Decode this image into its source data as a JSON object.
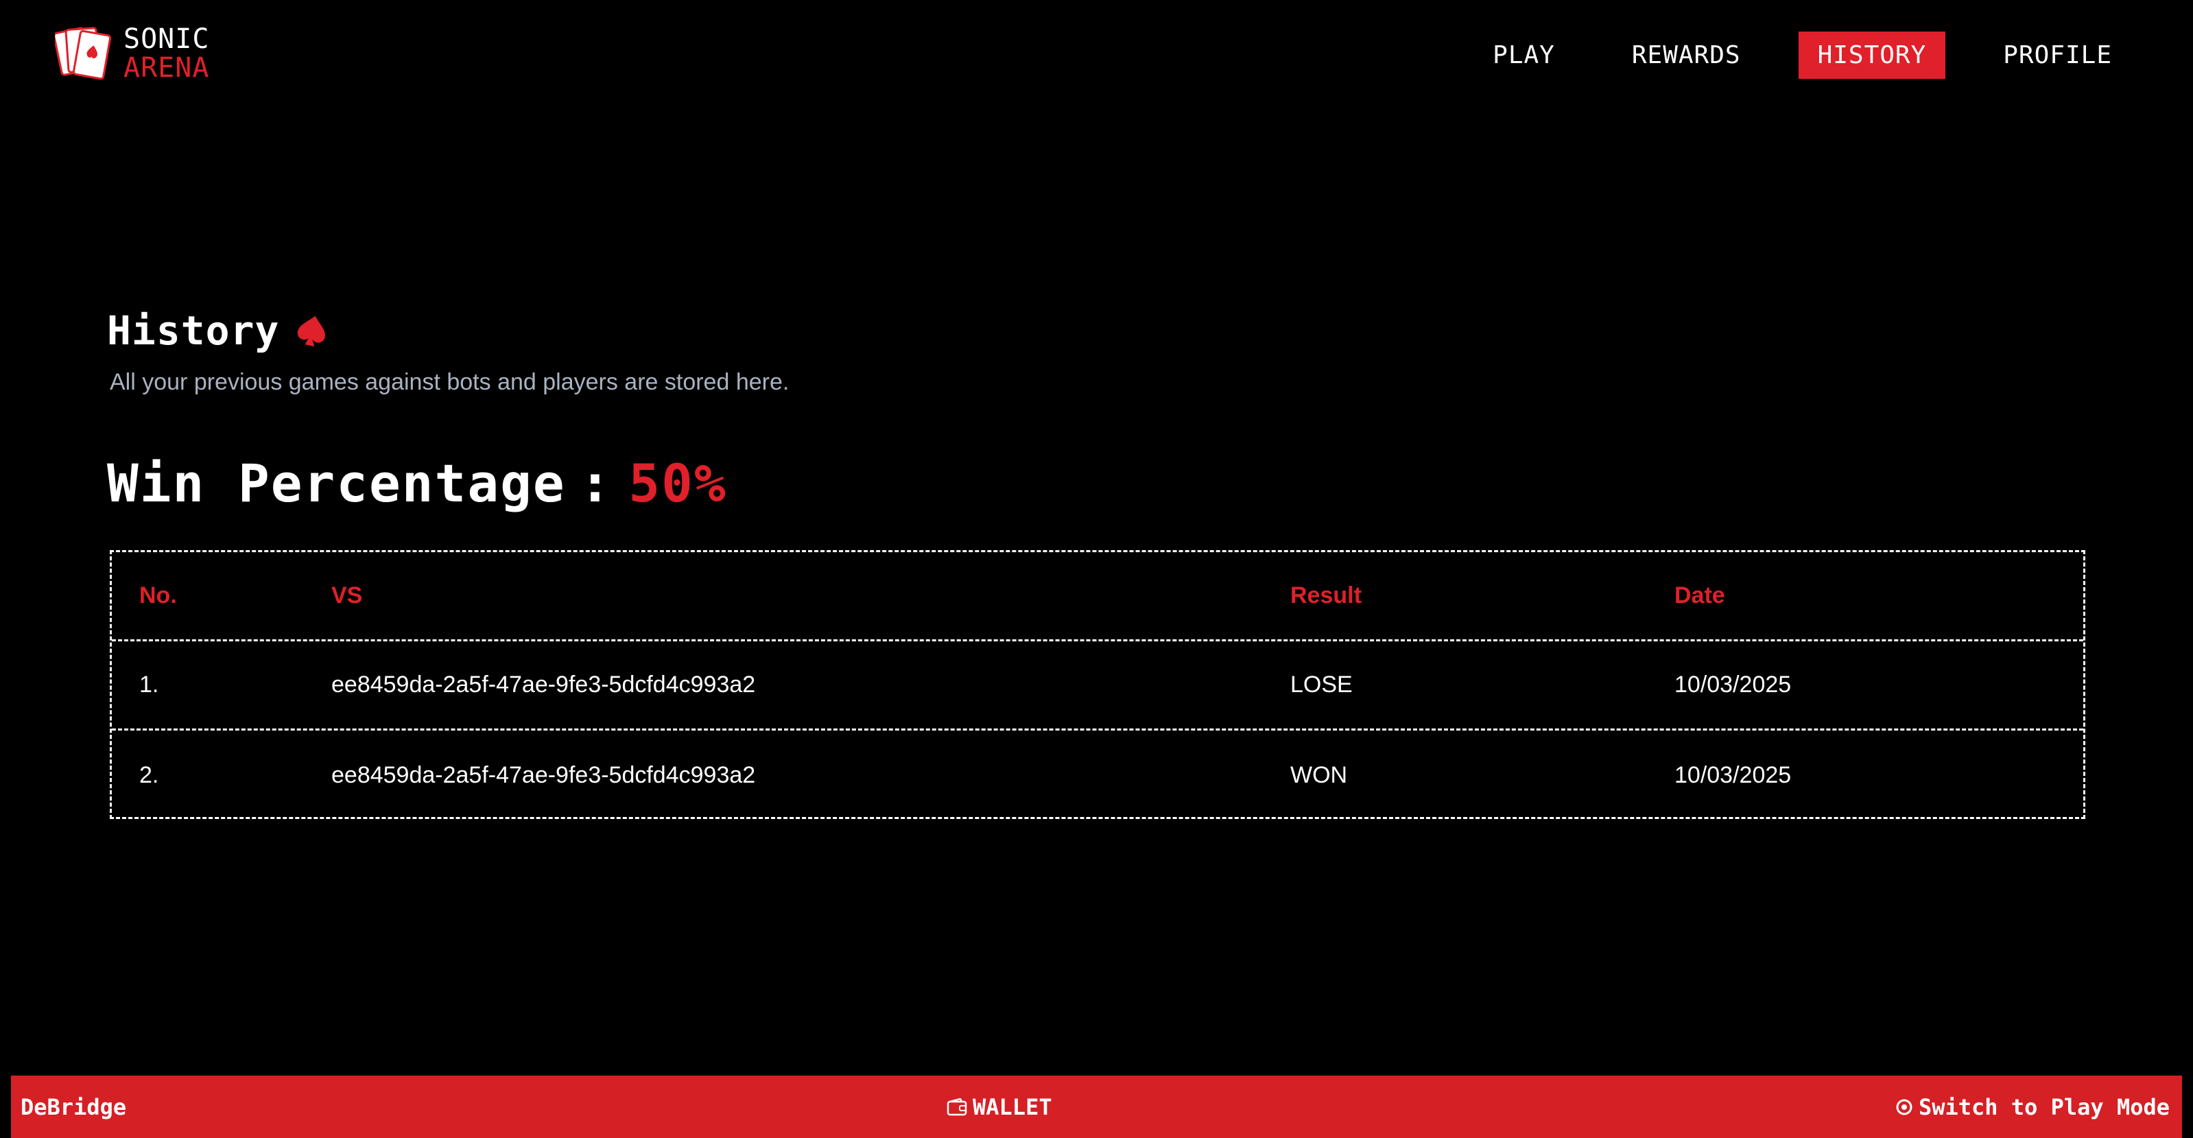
{
  "brand": {
    "line1": "SONIC",
    "line2": "ARENA"
  },
  "nav": {
    "items": [
      {
        "label": "PLAY",
        "active": false
      },
      {
        "label": "REWARDS",
        "active": false
      },
      {
        "label": "HISTORY",
        "active": true
      },
      {
        "label": "PROFILE",
        "active": false
      }
    ]
  },
  "page": {
    "title": "History",
    "subtitle": "All your previous games against bots and players are stored here.",
    "win_label": "Win Percentage",
    "win_separator": ":",
    "win_value": "50%"
  },
  "table": {
    "headers": {
      "no": "No.",
      "vs": "VS",
      "result": "Result",
      "date": "Date"
    },
    "rows": [
      {
        "no": "1.",
        "vs": "ee8459da-2a5f-47ae-9fe3-5dcfd4c993a2",
        "result": "LOSE",
        "date": "10/03/2025"
      },
      {
        "no": "2.",
        "vs": "ee8459da-2a5f-47ae-9fe3-5dcfd4c993a2",
        "result": "WON",
        "date": "10/03/2025"
      }
    ]
  },
  "footer": {
    "left_label": "DeBridge",
    "center_label": "WALLET",
    "center_icon": "wallet-icon",
    "right_label": "Switch to Play Mode",
    "right_icon": "switch-icon"
  },
  "colors": {
    "accent": "#e0202a",
    "footer_bg": "#d52025",
    "background": "#000000",
    "subtitle": "#a9b3c1"
  }
}
